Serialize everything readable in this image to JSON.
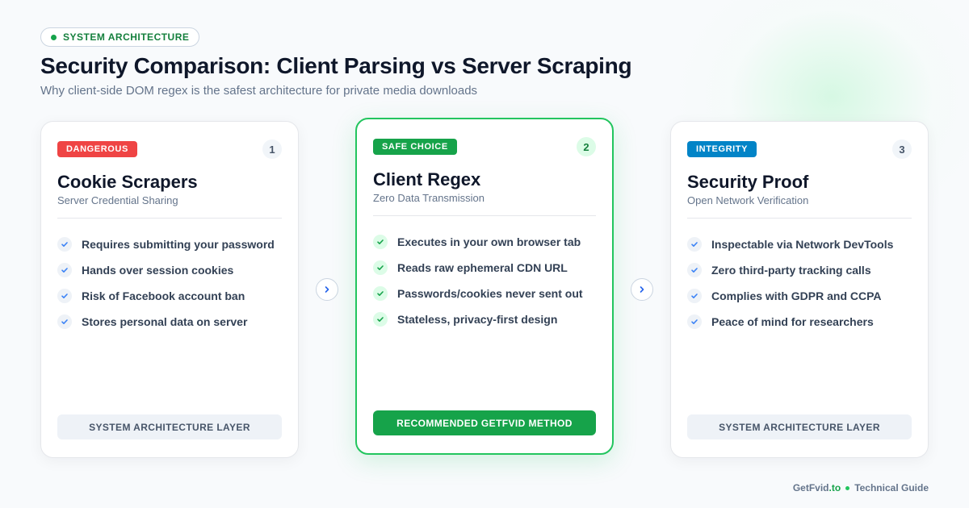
{
  "header": {
    "pill_label": "SYSTEM ARCHITECTURE",
    "title": "Security Comparison: Client Parsing vs Server Scraping",
    "subtitle": "Why client-side DOM regex is the safest architecture for private media downloads"
  },
  "cards": [
    {
      "badge": "DANGEROUS",
      "number": "1",
      "title": "Cookie Scrapers",
      "subtitle": "Server Credential Sharing",
      "items": [
        "Requires submitting your password",
        "Hands over session cookies",
        "Risk of Facebook account ban",
        "Stores personal data on server"
      ],
      "footer": "SYSTEM ARCHITECTURE LAYER"
    },
    {
      "badge": "SAFE CHOICE",
      "number": "2",
      "title": "Client Regex",
      "subtitle": "Zero Data Transmission",
      "items": [
        "Executes in your own browser tab",
        "Reads raw ephemeral CDN URL",
        "Passwords/cookies never sent out",
        "Stateless, privacy-first design"
      ],
      "footer": "RECOMMENDED GETFVID METHOD"
    },
    {
      "badge": "INTEGRITY",
      "number": "3",
      "title": "Security Proof",
      "subtitle": "Open Network Verification",
      "items": [
        "Inspectable via Network DevTools",
        "Zero third-party tracking calls",
        "Complies with GDPR and CCPA",
        "Peace of mind for researchers"
      ],
      "footer": "SYSTEM ARCHITECTURE LAYER"
    }
  ],
  "footer": {
    "brand_name": "GetFvid",
    "brand_tld": ".to",
    "guide": "Technical Guide"
  },
  "colors": {
    "danger": "#ef4444",
    "safe": "#16a34a",
    "integrity": "#0284c7",
    "check_blue": "#3b82f6",
    "check_green": "#16a34a"
  },
  "icons": {
    "check": "check-icon",
    "arrow": "chevron-right-icon",
    "status_dot": "dot-icon"
  }
}
